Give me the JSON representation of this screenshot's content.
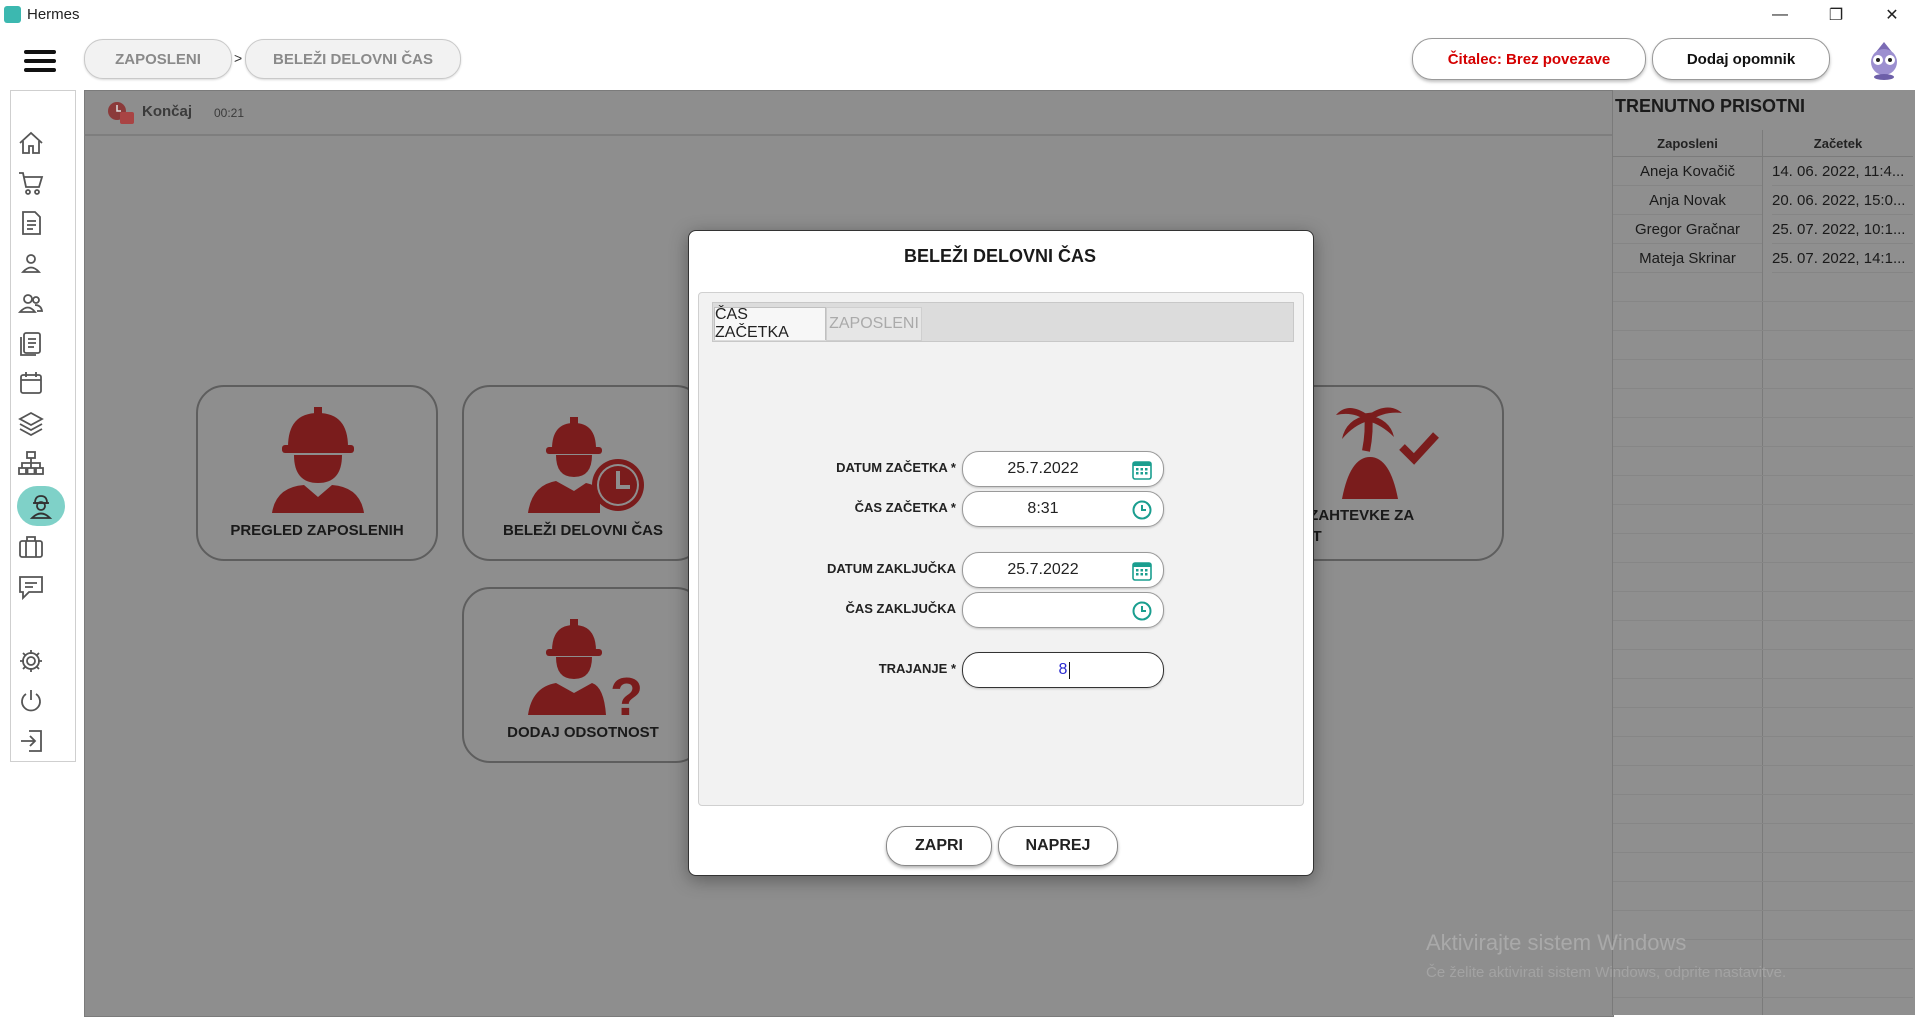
{
  "window": {
    "title": "Hermes",
    "controls": {
      "minimize": "—",
      "restore": "❐",
      "close": "✕"
    }
  },
  "breadcrumb": {
    "items": [
      "ZAPOSLENI",
      "BELEŽI DELOVNI ČAS"
    ],
    "separator": ">"
  },
  "topbar": {
    "reader_status": "Čitalec: Brez povezave",
    "add_reminder": "Dodaj opomnik"
  },
  "colors": {
    "reader_status": "#d40000",
    "tile_icon": "#7a1c1c",
    "accent": "#1a9e8f",
    "active_nav": "#7fd1c8"
  },
  "sidebar": {
    "items": [
      "home-icon",
      "cart-icon",
      "document-icon",
      "user-icon",
      "users-icon",
      "list-icon",
      "calendar-icon",
      "layers-icon",
      "hierarchy-icon",
      "worker-icon",
      "briefcase-icon",
      "chat-icon",
      "gear-icon",
      "power-icon",
      "logout-icon"
    ],
    "active": "worker-icon"
  },
  "session": {
    "end_label": "Končaj",
    "timer": "00:21"
  },
  "tiles": [
    {
      "label": "PREGLED ZAPOSLENIH"
    },
    {
      "label": "BELEŽI DELOVNI ČAS"
    },
    {
      "label": "DODAJ ODSOTNOST"
    },
    {
      "label": "TRDI ZAHTEVKE ZA",
      "label2": "OPUST"
    }
  ],
  "presence": {
    "title": "TRENUTNO PRISOTNI",
    "columns": [
      "Zaposleni",
      "Začetek"
    ],
    "rows": [
      [
        "Aneja  Kovačič",
        "14. 06. 2022, 11:4..."
      ],
      [
        "Anja Novak",
        "20. 06. 2022, 15:0..."
      ],
      [
        "Gregor Gračnar",
        "25. 07. 2022, 10:1..."
      ],
      [
        "Mateja Skrinar",
        "25. 07. 2022, 14:1..."
      ]
    ]
  },
  "watermark": {
    "line1": "Aktivirajte sistem Windows",
    "line2": "Če želite aktivirati sistem Windows, odprite nastavitve."
  },
  "modal": {
    "title": "BELEŽI DELOVNI ČAS",
    "tabs": [
      "ČAS ZAČETKA",
      "ZAPOSLENI"
    ],
    "fields": {
      "start_date": {
        "label": "DATUM ZAČETKA *",
        "value": "25.7.2022"
      },
      "start_time": {
        "label": "ČAS ZAČETKA *",
        "value": "8:31"
      },
      "end_date": {
        "label": "DATUM ZAKLJUČKA",
        "value": "25.7.2022"
      },
      "end_time": {
        "label": "ČAS ZAKLJUČKA",
        "value": ""
      },
      "duration": {
        "label": "TRAJANJE *",
        "value": "8"
      }
    },
    "buttons": {
      "close": "ZAPRI",
      "next": "NAPREJ"
    }
  }
}
